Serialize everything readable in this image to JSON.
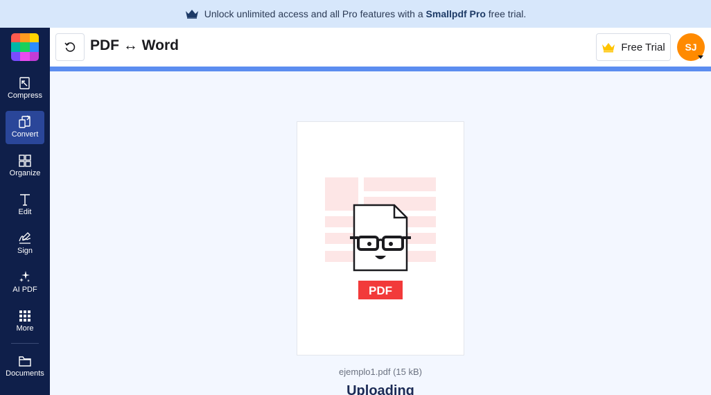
{
  "banner": {
    "prefix": "Unlock unlimited access and all Pro features with a",
    "brand": "Smallpdf Pro",
    "suffix": "free trial.",
    "icon": "crown-icon"
  },
  "sidebar": {
    "logo_colors": [
      "#ff5a4e",
      "#ff9b1f",
      "#ffd400",
      "#00b7a8",
      "#1ad05b",
      "#2c8cff",
      "#7a4bff",
      "#e94cf0",
      "#c43cd6"
    ],
    "items": [
      {
        "label": "Compress",
        "icon": "compress-icon"
      },
      {
        "label": "Convert",
        "icon": "convert-icon",
        "active": true
      },
      {
        "label": "Organize",
        "icon": "organize-icon"
      },
      {
        "label": "Edit",
        "icon": "edit-icon"
      },
      {
        "label": "Sign",
        "icon": "sign-icon"
      },
      {
        "label": "AI PDF",
        "icon": "ai-sparkle-icon"
      },
      {
        "label": "More",
        "icon": "more-grid-icon"
      },
      {
        "label": "Documents",
        "icon": "folder-icon"
      }
    ]
  },
  "topbar": {
    "title": "PDF ↔ Word",
    "free_trial_label": "Free Trial",
    "avatar_initials": "SJ",
    "back_icon": "undo-icon"
  },
  "upload": {
    "file_name": "ejemplo1.pdf (15 kB)",
    "status": "Uploading",
    "badge": "PDF",
    "progress": 1.0
  },
  "colors": {
    "accent": "#5b8df0",
    "sidebar_bg": "#0f1f4a",
    "banner_bg": "#d7e7fb",
    "pdf_red": "#f23a3a",
    "avatar": "#ff8a00"
  }
}
